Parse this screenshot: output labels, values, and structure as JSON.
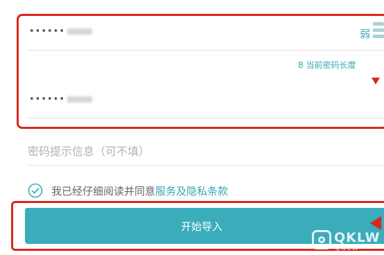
{
  "form": {
    "password_masked": "••••••",
    "strength_label": "弱",
    "length_note": "8 当前密码长度",
    "confirm_masked": "••••••",
    "hint_placeholder": "密码提示信息（可不填）"
  },
  "agreement": {
    "text": "我已经仔细阅读并同意",
    "link": "服务及隐私条款",
    "checked": true
  },
  "import_button": {
    "label": "开始导入"
  },
  "watermark": {
    "logo_text": "QKLW",
    "sub_text": "QKLW"
  },
  "colors": {
    "accent": "#3aacba",
    "highlight": "#d9261c"
  },
  "icons": [
    "check-circle-icon",
    "strength-bars-icon",
    "arrow-icon",
    "watermark-logo-icon"
  ]
}
